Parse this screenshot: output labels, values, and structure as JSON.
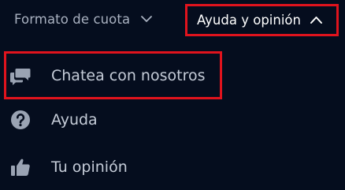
{
  "header": {
    "odds_format_label": "Formato de cuota",
    "help_feedback_label": "Ayuda y opinión"
  },
  "menu": {
    "items": [
      {
        "label": "Chatea con nosotros",
        "icon": "chat-bubbles-icon"
      },
      {
        "label": "Ayuda",
        "icon": "question-circle-icon"
      },
      {
        "label": "Tu opinión",
        "icon": "thumbs-up-icon"
      }
    ]
  },
  "colors": {
    "background": "#050d1e",
    "highlight": "#e0131d",
    "text_muted": "#a9b1c0",
    "text_menu": "#c5ccd8",
    "text_active": "#ffffff",
    "icon": "#9aa3b3"
  }
}
